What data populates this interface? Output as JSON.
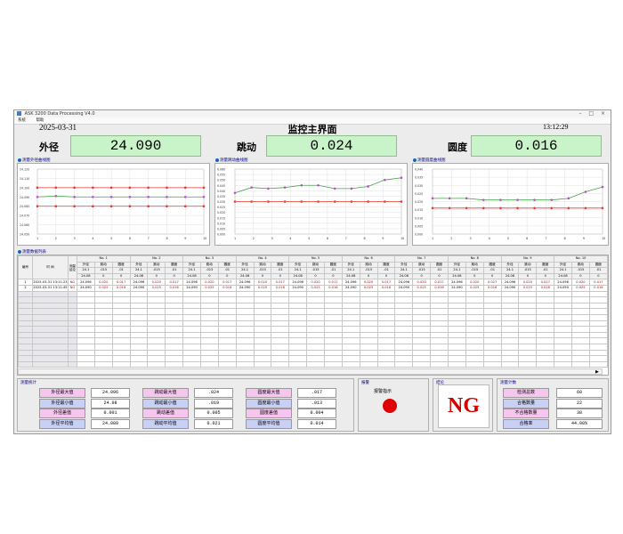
{
  "window": {
    "title": "ASK 3200 Data Processing V4.0",
    "menu": [
      "系统",
      "帮助"
    ]
  },
  "header": {
    "date": "2025-03-31",
    "title": "监控主界面",
    "time": "13:12:29"
  },
  "measures": [
    {
      "label": "外径",
      "value": "24.090"
    },
    {
      "label": "跳动",
      "value": "0.024"
    },
    {
      "label": "圆度",
      "value": "0.016"
    }
  ],
  "charts": [
    {
      "label": "测量外径曲线图",
      "yticks": [
        "24.120",
        "24.110",
        "24.100",
        "24.090",
        "24.080",
        "24.070",
        "24.060",
        "24.050"
      ],
      "xticks": [
        "1",
        "2",
        "3",
        "4",
        "5",
        "6",
        "7",
        "8",
        "9",
        "10"
      ]
    },
    {
      "label": "测量跳动曲线图",
      "yticks": [
        "0.060",
        "0.055",
        "0.050",
        "0.045",
        "0.040",
        "0.035",
        "0.030",
        "0.025",
        "0.020",
        "0.015",
        "0.010",
        "0.005",
        "0.000"
      ],
      "xticks": [
        "1",
        "2",
        "3",
        "4",
        "5",
        "6",
        "7",
        "8",
        "9",
        "10"
      ]
    },
    {
      "label": "测量圆度曲线图",
      "yticks": [
        "0.040",
        "0.035",
        "0.030",
        "0.025",
        "0.020",
        "0.015",
        "0.010",
        "0.005",
        "0.000"
      ],
      "xticks": [
        "1",
        "2",
        "3",
        "4",
        "5",
        "6",
        "7",
        "8",
        "9",
        "10"
      ]
    }
  ],
  "chart_data": [
    {
      "type": "line",
      "title": "测量外径曲线图",
      "x": [
        1,
        2,
        3,
        4,
        5,
        6,
        7,
        8,
        9,
        10
      ],
      "ylim": [
        24.05,
        24.12
      ],
      "series": [
        {
          "values": [
            24.1,
            24.1,
            24.1,
            24.1,
            24.1,
            24.1,
            24.1,
            24.1,
            24.1,
            24.1
          ],
          "color": "#e53935"
        },
        {
          "values": [
            24.09,
            24.091,
            24.09,
            24.09,
            24.09,
            24.09,
            24.09,
            24.09,
            24.09,
            24.09
          ],
          "color": "#43a047"
        },
        {
          "values": [
            24.08,
            24.08,
            24.08,
            24.08,
            24.08,
            24.08,
            24.08,
            24.08,
            24.08,
            24.08
          ],
          "color": "#e53935"
        }
      ]
    },
    {
      "type": "line",
      "title": "测量跳动曲线图",
      "x": [
        1,
        2,
        3,
        4,
        5,
        6,
        7,
        8,
        9,
        10
      ],
      "ylim": [
        0,
        0.06
      ],
      "series": [
        {
          "values": [
            0.038,
            0.043,
            0.042,
            0.043,
            0.045,
            0.045,
            0.042,
            0.042,
            0.044,
            0.05,
            0.052
          ],
          "color": "#43a047"
        },
        {
          "values": [
            0.03,
            0.03,
            0.03,
            0.03,
            0.03,
            0.03,
            0.03,
            0.03,
            0.03,
            0.03,
            0.03
          ],
          "color": "#e53935"
        }
      ]
    },
    {
      "type": "line",
      "title": "测量圆度曲线图",
      "x": [
        1,
        2,
        3,
        4,
        5,
        6,
        7,
        8,
        9,
        10
      ],
      "ylim": [
        0,
        0.04
      ],
      "series": [
        {
          "values": [
            0.022,
            0.022,
            0.022,
            0.021,
            0.021,
            0.021,
            0.021,
            0.021,
            0.022,
            0.026,
            0.029
          ],
          "color": "#43a047"
        },
        {
          "values": [
            0.016,
            0.016,
            0.016,
            0.016,
            0.016,
            0.016,
            0.016,
            0.016,
            0.016,
            0.016,
            0.016
          ],
          "color": "#e53935"
        }
      ]
    }
  ],
  "table": {
    "label": "测量数据列表",
    "col_no": "编号",
    "col_time": "时 间",
    "col_result": "测量结论",
    "point_header": [
      "No. 1",
      "No. 2",
      "No. 3",
      "No. 4",
      "No. 5",
      "No. 6",
      "No. 7",
      "No. 8",
      "No. 9",
      "No. 10"
    ],
    "sub_header": [
      "外径",
      "跳动",
      "圆度"
    ],
    "limit_upper": [
      "24.1",
      ".015",
      ".01"
    ],
    "limit_lower": [
      "24.08",
      "0",
      "0"
    ],
    "rows": [
      {
        "no": "1",
        "time": "2025-03-31 13:11:23",
        "result": "NG",
        "cells": [
          "24.096",
          "0.020",
          "0.017"
        ]
      },
      {
        "no": "2",
        "time": "2025-03-31 13:11:45",
        "result": "NG",
        "cells": [
          "24.090",
          "0.025",
          "0.016"
        ]
      }
    ]
  },
  "stats": {
    "label": "测量统计",
    "rows": [
      {
        "a_label": "外径最大值",
        "a_val": "24.096",
        "b_label": "跳动最大值",
        "b_val": ".024",
        "c_label": "圆度最大值",
        "c_val": ".017"
      },
      {
        "a_label": "外径最小值",
        "a_val": "24.08",
        "b_label": "跳动最小值",
        "b_val": ".019",
        "c_label": "圆度最小值",
        "c_val": ".013"
      },
      {
        "a_label": "外径差值",
        "a_val": "0.001",
        "b_label": "跳动差值",
        "b_val": "0.005",
        "c_label": "圆度差值",
        "c_val": "0.004"
      },
      {
        "a_label": "外径平均值",
        "a_val": "24.089",
        "b_label": "跳动平均值",
        "b_val": "0.021",
        "c_label": "圆度平均值",
        "c_val": "0.014"
      }
    ]
  },
  "alarm": {
    "label": "报警",
    "caption": "报警指示",
    "color": "#e00000"
  },
  "result": {
    "label": "结论",
    "text": "NG"
  },
  "count": {
    "label": "测量计数",
    "rows": [
      {
        "label": "检测总数",
        "value": "60"
      },
      {
        "label": "合格数量",
        "value": "22"
      },
      {
        "label": "不合格数量",
        "value": "38"
      },
      {
        "label": "合格率",
        "value": "44.00%"
      }
    ]
  }
}
